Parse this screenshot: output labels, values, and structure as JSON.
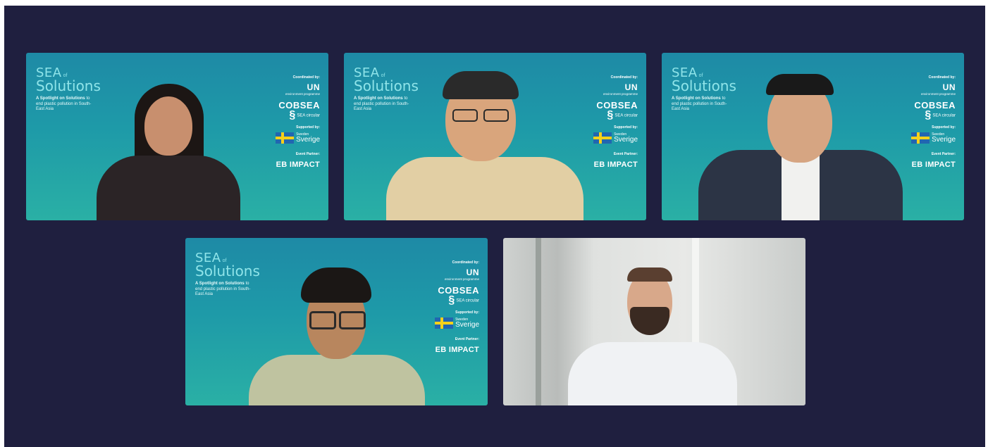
{
  "branding": {
    "title_sea": "SEA",
    "title_of": "of",
    "title_solutions": "Solutions",
    "tagline_bold": "A Spotlight on Solutions",
    "tagline_rest": "to end plastic pollution in South-East Asia",
    "coordinated_label": "Coordinated by:",
    "un_logo": "UN",
    "un_sub": "environment programme",
    "cobsea": "COBSEA",
    "sea_circular": "SEA circular",
    "supported_label": "Supported by:",
    "sweden_small": "Sweden",
    "sweden_big": "Sverige",
    "event_partner_label": "Event Partner:",
    "event_partner": "EB IMPACT"
  },
  "participants": [
    {
      "id": "p1",
      "background": "branded"
    },
    {
      "id": "p2",
      "background": "branded"
    },
    {
      "id": "p3",
      "background": "branded"
    },
    {
      "id": "p4",
      "background": "branded"
    },
    {
      "id": "p5",
      "background": "office"
    }
  ],
  "colors": {
    "stage": "#1f1f3f",
    "brand_teal": "#1e9aa8",
    "brand_text": "#8fe4e9"
  }
}
